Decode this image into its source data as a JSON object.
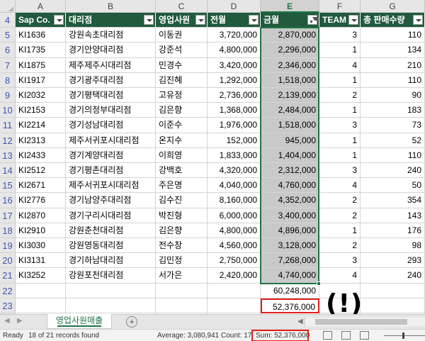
{
  "columns": [
    "A",
    "B",
    "C",
    "D",
    "E",
    "F",
    "G"
  ],
  "selected_column": "E",
  "headers": [
    "Sap Co.",
    "대리점",
    "영업사원",
    "전월",
    "금월",
    "TEAM",
    "총 판매수량"
  ],
  "filtered_header_index": 4,
  "header_row_number": "4",
  "rows": [
    {
      "n": "5",
      "cells": [
        "KI1636",
        "강원속초대리점",
        "이동권",
        "3,720,000",
        "2,870,000",
        "3",
        "110"
      ]
    },
    {
      "n": "6",
      "cells": [
        "KI1735",
        "경기안양대리점",
        "강준석",
        "4,800,000",
        "2,296,000",
        "1",
        "134"
      ]
    },
    {
      "n": "7",
      "cells": [
        "KI1875",
        "제주제주시대리점",
        "민경수",
        "3,420,000",
        "2,346,000",
        "4",
        "210"
      ]
    },
    {
      "n": "8",
      "cells": [
        "KI1917",
        "경기광주대리점",
        "김진혜",
        "1,292,000",
        "1,518,000",
        "1",
        "110"
      ]
    },
    {
      "n": "9",
      "cells": [
        "KI2032",
        "경기평택대리점",
        "고유정",
        "2,736,000",
        "2,139,000",
        "2",
        "90"
      ]
    },
    {
      "n": "10",
      "cells": [
        "KI2153",
        "경기의정부대리점",
        "김은향",
        "1,368,000",
        "2,484,000",
        "1",
        "183"
      ]
    },
    {
      "n": "11",
      "cells": [
        "KI2214",
        "경기성남대리점",
        "이준수",
        "1,976,000",
        "1,518,000",
        "3",
        "73"
      ]
    },
    {
      "n": "12",
      "cells": [
        "KI2313",
        "제주서귀포시대리점",
        "온지수",
        "152,000",
        "945,000",
        "1",
        "52"
      ]
    },
    {
      "n": "13",
      "cells": [
        "KI2433",
        "경기계양대리점",
        "이희영",
        "1,833,000",
        "1,404,000",
        "1",
        "110"
      ]
    },
    {
      "n": "14",
      "cells": [
        "KI2512",
        "경기평촌대리점",
        "강백호",
        "4,320,000",
        "2,312,000",
        "3",
        "240"
      ]
    },
    {
      "n": "15",
      "cells": [
        "KI2671",
        "제주서귀포시대리점",
        "주은명",
        "4,040,000",
        "4,760,000",
        "4",
        "50"
      ]
    },
    {
      "n": "16",
      "cells": [
        "KI2776",
        "경기남양주대리점",
        "김수진",
        "8,160,000",
        "4,352,000",
        "2",
        "354"
      ]
    },
    {
      "n": "17",
      "cells": [
        "KI2870",
        "경기구리시대리점",
        "박진형",
        "6,000,000",
        "3,400,000",
        "2",
        "143"
      ]
    },
    {
      "n": "18",
      "cells": [
        "KI2910",
        "강원춘천대리점",
        "김은향",
        "4,800,000",
        "4,896,000",
        "1",
        "176"
      ]
    },
    {
      "n": "19",
      "cells": [
        "KI3030",
        "강원영동대리점",
        "전수창",
        "4,560,000",
        "3,128,000",
        "2",
        "98"
      ]
    },
    {
      "n": "20",
      "cells": [
        "KI3131",
        "경기하남대리점",
        "김민정",
        "2,750,000",
        "7,268,000",
        "3",
        "293"
      ]
    },
    {
      "n": "21",
      "cells": [
        "KI3252",
        "강원포천대리점",
        "서가은",
        "2,420,000",
        "4,740,000",
        "4",
        "240"
      ]
    }
  ],
  "extra_rows": [
    {
      "n": "22",
      "e": "60,248,000"
    },
    {
      "n": "23",
      "e": "52,376,000"
    },
    {
      "n": "24",
      "e": ""
    }
  ],
  "annotation": "(!)",
  "sheet_tab": "영업사원매출",
  "add_sheet_symbol": "+",
  "status": {
    "ready": "Ready",
    "found": "18 of 21 records found",
    "average": "Average:  3,080,941",
    "count": "Count: 17",
    "sum": "Sum:  52,376,000"
  },
  "colors": {
    "header_bg": "#215a3c",
    "accent": "#217346",
    "highlight": "#e0201a"
  }
}
